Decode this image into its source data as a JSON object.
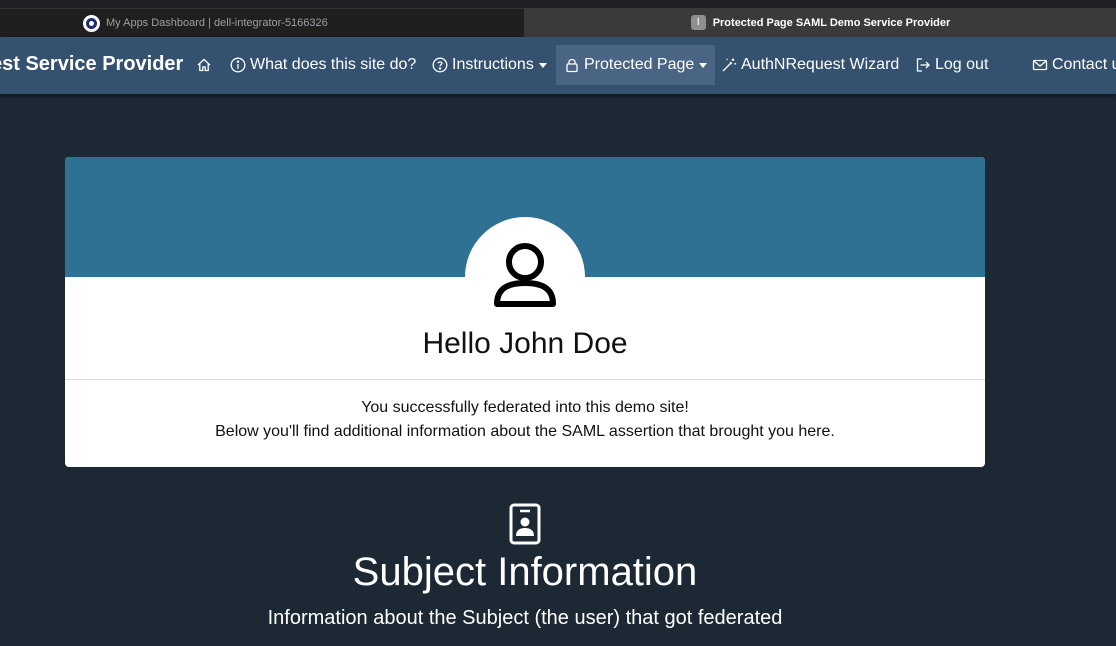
{
  "browser": {
    "tabs": [
      {
        "title": "My Apps Dashboard | dell-integrator-5166326",
        "favicon": "okta-icon",
        "active": false
      },
      {
        "title": "Protected Page SAML Demo Service Provider",
        "favicon_letter": "I",
        "active": true
      }
    ]
  },
  "navbar": {
    "brand": "est Service Provider",
    "items": [
      {
        "label": "",
        "icon": "home-icon"
      },
      {
        "label": "What does this site do?",
        "icon": "info-circle-icon"
      },
      {
        "label": "Instructions",
        "icon": "question-circle-icon",
        "dropdown": true
      },
      {
        "label": "Protected Page",
        "icon": "lock-icon",
        "dropdown": true,
        "active": true
      },
      {
        "label": "AuthNRequest Wizard",
        "icon": "magic-wand-icon"
      },
      {
        "label": "Log out",
        "icon": "logout-icon"
      },
      {
        "label": "Contact u",
        "icon": "envelope-icon"
      }
    ]
  },
  "hero": {
    "greeting": "Hello John Doe",
    "message_line1": "You successfully federated into this demo site!",
    "message_line2": "Below you'll find additional information about the SAML assertion that brought you here."
  },
  "subject": {
    "title": "Subject Information",
    "subtitle": "Information about the Subject (the user) that got federated"
  },
  "colors": {
    "page_bg": "#1c2833",
    "navbar_bg": "#34516f",
    "card_header_bg": "#2e7193",
    "active_nav_bg": "#4a6583"
  }
}
